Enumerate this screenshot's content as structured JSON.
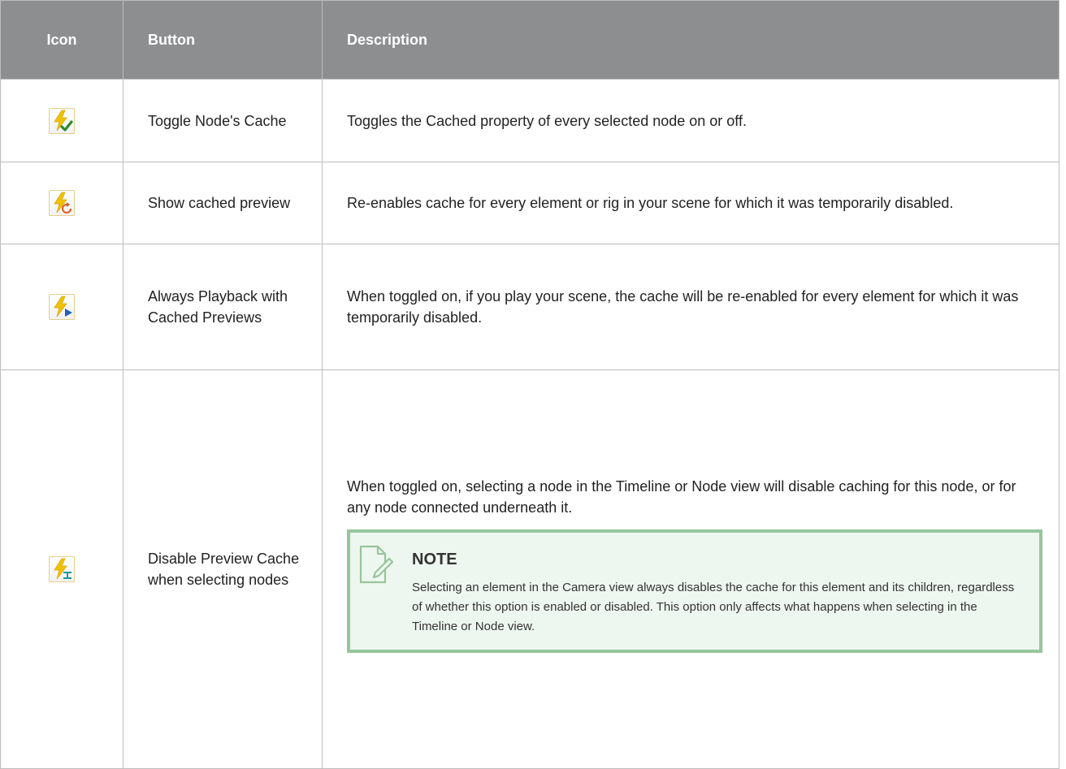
{
  "table": {
    "headers": [
      "Icon",
      "Button",
      "Description"
    ],
    "rows": [
      {
        "icon": "lightning-check-icon",
        "button": "Toggle Node's Cache",
        "description": "Toggles the Cached property of every selected node on or off."
      },
      {
        "icon": "lightning-refresh-icon",
        "button": "Show cached preview",
        "description": "Re-enables cache for every element or rig in your scene for which it was temporarily disabled."
      },
      {
        "icon": "lightning-play-icon",
        "button": "Always Playback with Cached Previews",
        "description": "When toggled on, if you play your scene, the cache will be re-enabled for every element for which it was temporarily disabled."
      },
      {
        "icon": "lightning-select-icon",
        "button": "Disable Preview Cache when selecting nodes",
        "description": "When toggled on, selecting a node in the Timeline or Node view will disable caching for this node, or for any node connected underneath it.",
        "note": {
          "title": "NOTE",
          "icon": "note-pencil-icon",
          "text": "Selecting an element in the Camera view always disables the cache for this element and its children, regardless of whether this option is enabled or disabled. This option only affects what happens when selecting in the Timeline or Node view."
        }
      }
    ]
  },
  "colors": {
    "header_bg": "#8d8e8f",
    "note_border": "#97c59c",
    "note_bg": "#eef7ef",
    "bolt_yellow": "#f2c200",
    "check_green": "#2e8b2e",
    "refresh_orange": "#e0561a",
    "play_blue": "#1f5fbf",
    "select_teal": "#1a9a9a"
  }
}
